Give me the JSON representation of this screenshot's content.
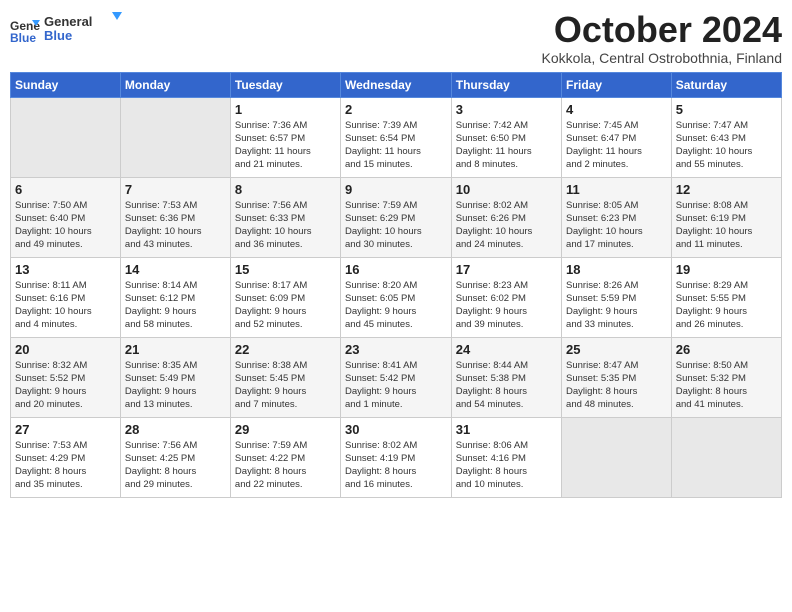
{
  "header": {
    "logo_line1": "General",
    "logo_line2": "Blue",
    "month_year": "October 2024",
    "location": "Kokkola, Central Ostrobothnia, Finland"
  },
  "days_of_week": [
    "Sunday",
    "Monday",
    "Tuesday",
    "Wednesday",
    "Thursday",
    "Friday",
    "Saturday"
  ],
  "weeks": [
    [
      {
        "day": "",
        "info": ""
      },
      {
        "day": "",
        "info": ""
      },
      {
        "day": "1",
        "info": "Sunrise: 7:36 AM\nSunset: 6:57 PM\nDaylight: 11 hours\nand 21 minutes."
      },
      {
        "day": "2",
        "info": "Sunrise: 7:39 AM\nSunset: 6:54 PM\nDaylight: 11 hours\nand 15 minutes."
      },
      {
        "day": "3",
        "info": "Sunrise: 7:42 AM\nSunset: 6:50 PM\nDaylight: 11 hours\nand 8 minutes."
      },
      {
        "day": "4",
        "info": "Sunrise: 7:45 AM\nSunset: 6:47 PM\nDaylight: 11 hours\nand 2 minutes."
      },
      {
        "day": "5",
        "info": "Sunrise: 7:47 AM\nSunset: 6:43 PM\nDaylight: 10 hours\nand 55 minutes."
      }
    ],
    [
      {
        "day": "6",
        "info": "Sunrise: 7:50 AM\nSunset: 6:40 PM\nDaylight: 10 hours\nand 49 minutes."
      },
      {
        "day": "7",
        "info": "Sunrise: 7:53 AM\nSunset: 6:36 PM\nDaylight: 10 hours\nand 43 minutes."
      },
      {
        "day": "8",
        "info": "Sunrise: 7:56 AM\nSunset: 6:33 PM\nDaylight: 10 hours\nand 36 minutes."
      },
      {
        "day": "9",
        "info": "Sunrise: 7:59 AM\nSunset: 6:29 PM\nDaylight: 10 hours\nand 30 minutes."
      },
      {
        "day": "10",
        "info": "Sunrise: 8:02 AM\nSunset: 6:26 PM\nDaylight: 10 hours\nand 24 minutes."
      },
      {
        "day": "11",
        "info": "Sunrise: 8:05 AM\nSunset: 6:23 PM\nDaylight: 10 hours\nand 17 minutes."
      },
      {
        "day": "12",
        "info": "Sunrise: 8:08 AM\nSunset: 6:19 PM\nDaylight: 10 hours\nand 11 minutes."
      }
    ],
    [
      {
        "day": "13",
        "info": "Sunrise: 8:11 AM\nSunset: 6:16 PM\nDaylight: 10 hours\nand 4 minutes."
      },
      {
        "day": "14",
        "info": "Sunrise: 8:14 AM\nSunset: 6:12 PM\nDaylight: 9 hours\nand 58 minutes."
      },
      {
        "day": "15",
        "info": "Sunrise: 8:17 AM\nSunset: 6:09 PM\nDaylight: 9 hours\nand 52 minutes."
      },
      {
        "day": "16",
        "info": "Sunrise: 8:20 AM\nSunset: 6:05 PM\nDaylight: 9 hours\nand 45 minutes."
      },
      {
        "day": "17",
        "info": "Sunrise: 8:23 AM\nSunset: 6:02 PM\nDaylight: 9 hours\nand 39 minutes."
      },
      {
        "day": "18",
        "info": "Sunrise: 8:26 AM\nSunset: 5:59 PM\nDaylight: 9 hours\nand 33 minutes."
      },
      {
        "day": "19",
        "info": "Sunrise: 8:29 AM\nSunset: 5:55 PM\nDaylight: 9 hours\nand 26 minutes."
      }
    ],
    [
      {
        "day": "20",
        "info": "Sunrise: 8:32 AM\nSunset: 5:52 PM\nDaylight: 9 hours\nand 20 minutes."
      },
      {
        "day": "21",
        "info": "Sunrise: 8:35 AM\nSunset: 5:49 PM\nDaylight: 9 hours\nand 13 minutes."
      },
      {
        "day": "22",
        "info": "Sunrise: 8:38 AM\nSunset: 5:45 PM\nDaylight: 9 hours\nand 7 minutes."
      },
      {
        "day": "23",
        "info": "Sunrise: 8:41 AM\nSunset: 5:42 PM\nDaylight: 9 hours\nand 1 minute."
      },
      {
        "day": "24",
        "info": "Sunrise: 8:44 AM\nSunset: 5:38 PM\nDaylight: 8 hours\nand 54 minutes."
      },
      {
        "day": "25",
        "info": "Sunrise: 8:47 AM\nSunset: 5:35 PM\nDaylight: 8 hours\nand 48 minutes."
      },
      {
        "day": "26",
        "info": "Sunrise: 8:50 AM\nSunset: 5:32 PM\nDaylight: 8 hours\nand 41 minutes."
      }
    ],
    [
      {
        "day": "27",
        "info": "Sunrise: 7:53 AM\nSunset: 4:29 PM\nDaylight: 8 hours\nand 35 minutes."
      },
      {
        "day": "28",
        "info": "Sunrise: 7:56 AM\nSunset: 4:25 PM\nDaylight: 8 hours\nand 29 minutes."
      },
      {
        "day": "29",
        "info": "Sunrise: 7:59 AM\nSunset: 4:22 PM\nDaylight: 8 hours\nand 22 minutes."
      },
      {
        "day": "30",
        "info": "Sunrise: 8:02 AM\nSunset: 4:19 PM\nDaylight: 8 hours\nand 16 minutes."
      },
      {
        "day": "31",
        "info": "Sunrise: 8:06 AM\nSunset: 4:16 PM\nDaylight: 8 hours\nand 10 minutes."
      },
      {
        "day": "",
        "info": ""
      },
      {
        "day": "",
        "info": ""
      }
    ]
  ]
}
